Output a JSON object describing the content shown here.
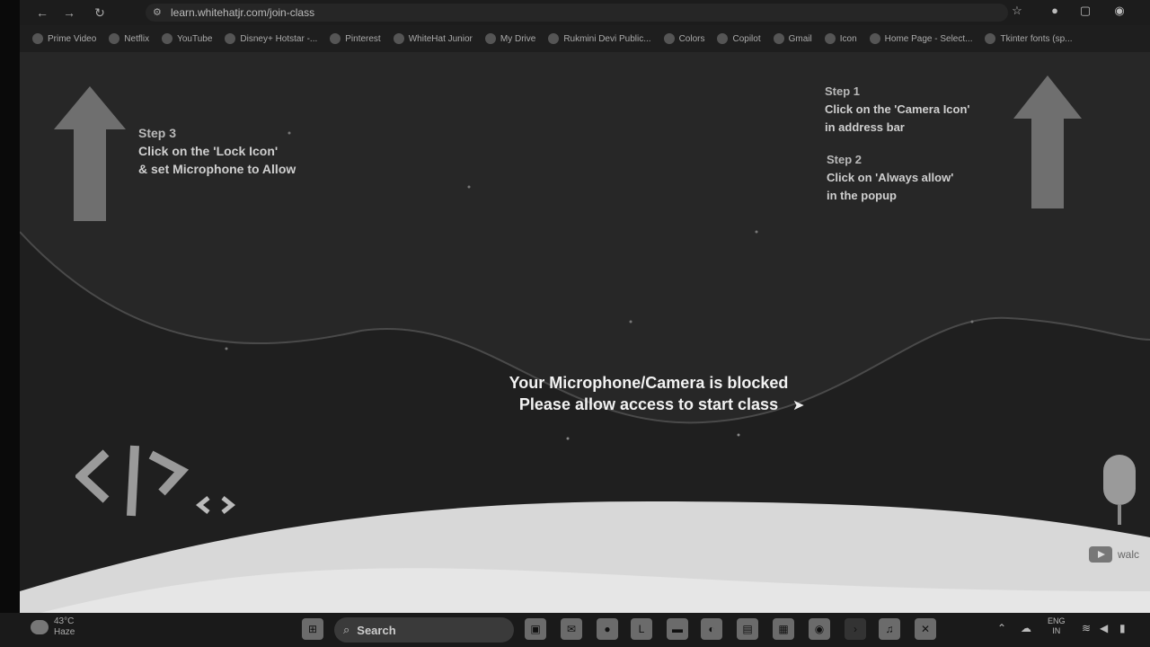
{
  "browser": {
    "url": "learn.whitehatjr.com/join-class",
    "bookmarks": [
      "Prime Video",
      "Netflix",
      "YouTube",
      "Disney+ Hotstar -...",
      "Pinterest",
      "WhiteHat Junior",
      "My Drive",
      "Rukmini Devi Public...",
      "Colors",
      "Copilot",
      "Gmail",
      "Icon",
      "Home Page - Select...",
      "Tkinter fonts (sp..."
    ]
  },
  "steps": {
    "step1_title": "Step 1",
    "step1_line1": "Click on the 'Camera Icon'",
    "step1_line2": "in address bar",
    "step2_title": "Step 2",
    "step2_line1": "Click on 'Always allow'",
    "step2_line2": "in the popup",
    "step3_title": "Step 3",
    "step3_line1": "Click on the 'Lock Icon'",
    "step3_line2": "& set Microphone to Allow"
  },
  "message": {
    "line1": "Your Microphone/Camera is blocked",
    "line2": "Please allow access to start class"
  },
  "watermark": "walc",
  "taskbar": {
    "weather_temp": "43°C",
    "weather_desc": "Haze",
    "search_label": "Search",
    "lang_line1": "ENG",
    "lang_line2": "IN"
  }
}
